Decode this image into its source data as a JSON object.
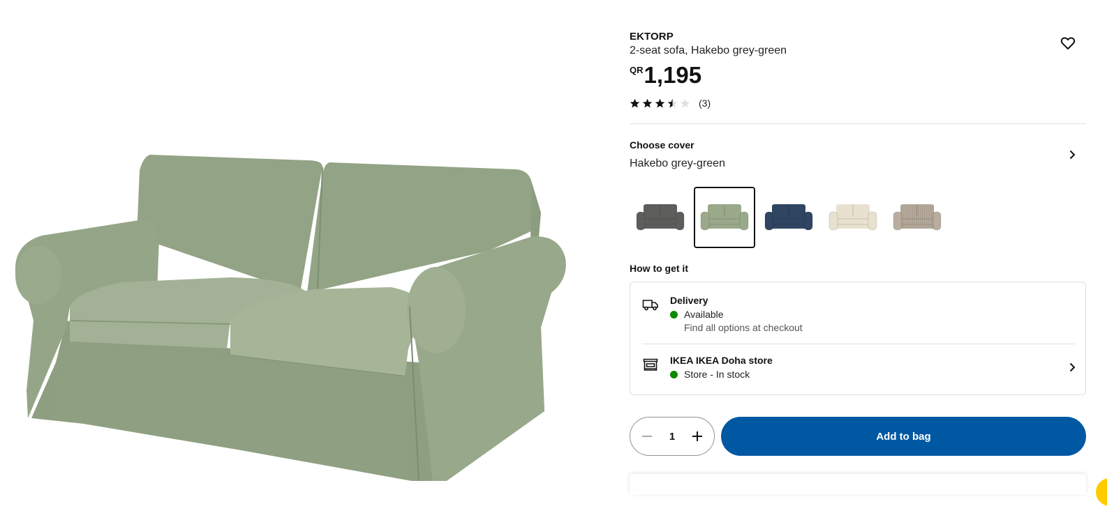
{
  "product": {
    "name": "EKTORP",
    "description": "2-seat sofa, Hakebo grey-green",
    "currency": "QR",
    "price": "1,195",
    "rating": 3.5,
    "rating_max": 5,
    "reviews_count": "(3)"
  },
  "cover": {
    "title": "Choose cover",
    "selected": "Hakebo grey-green",
    "swatches": [
      {
        "name": "dark grey",
        "color": "#5d5e5b",
        "selected": false
      },
      {
        "name": "Hakebo grey-green",
        "color": "#9aa98a",
        "selected": true
      },
      {
        "name": "dark blue",
        "color": "#2f4562",
        "selected": false
      },
      {
        "name": "beige",
        "color": "#e8e1cf",
        "selected": false
      },
      {
        "name": "striped beige",
        "color": "#b9ae9e",
        "selected": false
      }
    ]
  },
  "how_to_get": {
    "title": "How to get it",
    "delivery": {
      "title": "Delivery",
      "status": "Available",
      "note": "Find all options at checkout"
    },
    "store": {
      "title": "IKEA IKEA Doha store",
      "status": "Store - In stock"
    }
  },
  "cart": {
    "quantity": "1",
    "add_label": "Add to bag"
  },
  "colors": {
    "accent": "#0058a3",
    "in_stock": "#0a8a00",
    "sofa": "#95a587"
  },
  "icons": {
    "favourite": "heart-icon",
    "chevron": "chevron-right-icon",
    "delivery": "truck-icon",
    "store": "store-icon",
    "decrease": "minus-icon",
    "increase": "plus-icon"
  }
}
